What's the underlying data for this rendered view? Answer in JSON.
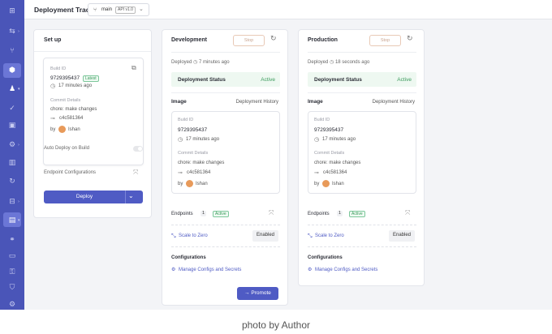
{
  "header": {
    "title": "Deployment Track",
    "branch": "main",
    "branch_tag": "API v1.0"
  },
  "sidebar": {
    "icons": [
      "grid-icon",
      "route-icon",
      "flow-icon",
      "deploy-icon",
      "user-icon",
      "check-icon",
      "box-icon",
      "settings-icon",
      "chart-icon",
      "history-icon",
      "network-icon",
      "stack-icon",
      "link-icon",
      "doc-icon",
      "key-icon",
      "shield-icon",
      "gear-icon"
    ]
  },
  "setup": {
    "title": "Set up",
    "build_id_label": "Build ID",
    "build_id": "9729395437",
    "latest_badge": "Latest",
    "time": "17 minutes ago",
    "commit_label": "Commit Details",
    "commit_message": "chore: make changes",
    "commit_hash": "c4c581364",
    "by_label": "by",
    "author": "Ishan",
    "auto_deploy_label": "Auto Deploy on Build",
    "endpoint_label": "Endpoint Configurations",
    "deploy_label": "Deploy"
  },
  "environments": [
    {
      "name": "Development",
      "stop_label": "Stop",
      "deployed_label": "Deployed",
      "deployed_time": "7 minutes ago",
      "status_label": "Deployment Status",
      "status_value": "Active",
      "image_label": "Image",
      "history_label": "Deployment History",
      "build_id_label": "Build ID",
      "build_id": "9729395437",
      "time": "17 minutes ago",
      "commit_label": "Commit Details",
      "commit_message": "chore: make changes",
      "commit_hash": "c4c581364",
      "by_label": "by",
      "author": "Ishan",
      "endpoints_label": "Endpoints",
      "endpoints_count": "1",
      "endpoints_status": "Active",
      "scale_label": "Scale to Zero",
      "scale_value": "Enabled",
      "config_label": "Configurations",
      "manage_label": "Manage Configs and Secrets",
      "promote_label": "Promote"
    },
    {
      "name": "Production",
      "stop_label": "Stop",
      "deployed_label": "Deployed",
      "deployed_time": "18 seconds ago",
      "status_label": "Deployment Status",
      "status_value": "Active",
      "image_label": "Image",
      "history_label": "Deployment History",
      "build_id_label": "Build ID",
      "build_id": "9729395437",
      "time": "17 minutes ago",
      "commit_label": "Commit Details",
      "commit_message": "chore: make changes",
      "commit_hash": "c4c581364",
      "by_label": "by",
      "author": "Ishan",
      "endpoints_label": "Endpoints",
      "endpoints_count": "1",
      "endpoints_status": "Active",
      "scale_label": "Scale to Zero",
      "scale_value": "Enabled",
      "config_label": "Configurations",
      "manage_label": "Manage Configs and Secrets"
    }
  ],
  "caption": "photo by Author",
  "colors": {
    "sidebar": "#4a55b8",
    "primary": "#4f5bc4",
    "success": "#3a9a5b"
  }
}
